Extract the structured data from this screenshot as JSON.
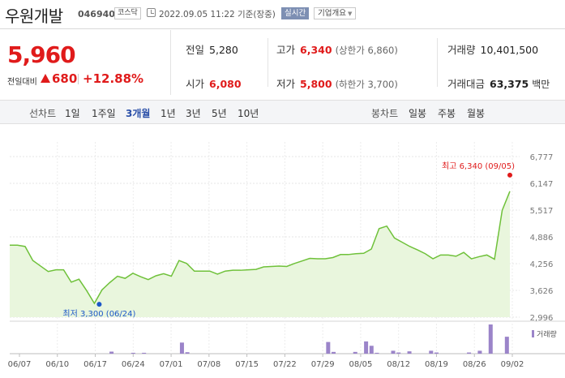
{
  "header": {
    "name": "우원개발",
    "code": "046940",
    "market": "코스닥",
    "timestamp": "2022.09.05 11:22 기준(장중)",
    "realtime": "실시간",
    "company_info": "기업개요"
  },
  "price": {
    "current": "5,960",
    "change_label": "전일대비",
    "change_value": "680",
    "change_pct": "+12.88%"
  },
  "stats": {
    "prev_close_label": "전일",
    "prev_close": "5,280",
    "high_label": "고가",
    "high": "6,340",
    "upper_limit": "(상한가 6,860)",
    "volume_label": "거래량",
    "volume": "10,401,500",
    "open_label": "시가",
    "open": "6,080",
    "low_label": "저가",
    "low": "5,800",
    "lower_limit": "(하한가 3,700)",
    "value_label": "거래대금",
    "value": "63,375",
    "value_unit": "백만"
  },
  "periods": {
    "line_label": "선차트",
    "line_options": [
      "1일",
      "1주일",
      "3개월",
      "1년",
      "3년",
      "5년",
      "10년"
    ],
    "active": "3개월",
    "candle_label": "봉차트",
    "candle_options": [
      "일봉",
      "주봉",
      "월봉"
    ]
  },
  "colors": {
    "up": "#e01b1b",
    "line": "#6fc13a",
    "fill": "#e9f6dd",
    "volume": "#9b84c9",
    "low_marker": "#1c57c8"
  },
  "chart_data": {
    "type": "area",
    "y_ticks": [
      "6,777",
      "6,147",
      "5,517",
      "4,886",
      "4,256",
      "3,626",
      "2,996"
    ],
    "ylim": [
      2996,
      6777
    ],
    "x_labels": [
      "06/07",
      "06/10",
      "06/17",
      "06/24",
      "07/01",
      "07/08",
      "07/15",
      "07/22",
      "07/29",
      "08/05",
      "08/12",
      "08/19",
      "08/26",
      "09/02"
    ],
    "high_annotation": "최고 6,340 (09/05)",
    "low_annotation": "최저 3,300 (06/24)",
    "volume_legend": "거래량",
    "series": [
      {
        "values": [
          4690,
          4690,
          4660,
          4330,
          4200,
          4070,
          4110,
          4110,
          3820,
          3890,
          3620,
          3320,
          3640,
          3810,
          3960,
          3910,
          4030,
          3950,
          3880,
          3970,
          4020,
          3960,
          4330,
          4260,
          4080,
          4080,
          4080,
          4010,
          4080,
          4100,
          4100,
          4110,
          4120,
          4180,
          4190,
          4200,
          4190,
          4260,
          4320,
          4380,
          4370,
          4370,
          4400,
          4470,
          4470,
          4490,
          4500,
          4600,
          5080,
          5140,
          4860,
          4760,
          4660,
          4580,
          4490,
          4370,
          4460,
          4460,
          4430,
          4520,
          4370,
          4420,
          4460,
          4360,
          5510,
          5960
        ]
      }
    ],
    "volume": [
      {
        "x": "06/24",
        "v": 0.07
      },
      {
        "x": "06/28",
        "v": 0.03
      },
      {
        "x": "06/30",
        "v": 0.03
      },
      {
        "x": "07/07",
        "v": 0.38
      },
      {
        "x": "07/08",
        "v": 0.05
      },
      {
        "x": "08/03",
        "v": 0.4
      },
      {
        "x": "08/04",
        "v": 0.06
      },
      {
        "x": "08/08",
        "v": 0.06
      },
      {
        "x": "08/10",
        "v": 0.42
      },
      {
        "x": "08/11",
        "v": 0.27
      },
      {
        "x": "08/12",
        "v": 0.03
      },
      {
        "x": "08/15",
        "v": 0.1
      },
      {
        "x": "08/16",
        "v": 0.04
      },
      {
        "x": "08/18",
        "v": 0.08
      },
      {
        "x": "08/22",
        "v": 0.1
      },
      {
        "x": "08/23",
        "v": 0.04
      },
      {
        "x": "08/29",
        "v": 0.04
      },
      {
        "x": "08/31",
        "v": 0.1
      },
      {
        "x": "09/02",
        "v": 1.0
      },
      {
        "x": "09/05",
        "v": 0.58
      }
    ]
  }
}
